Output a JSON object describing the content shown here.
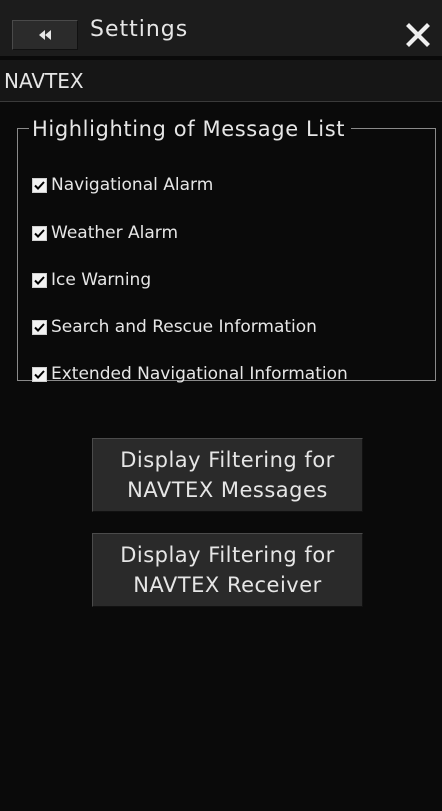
{
  "window": {
    "title": "Settings",
    "collapse_icon": "double-chevron-left-icon",
    "close_icon": "close-icon"
  },
  "section": {
    "title": "NAVTEX"
  },
  "highlight_group": {
    "legend": "Highlighting of Message List",
    "items": [
      {
        "label": "Navigational Alarm",
        "checked": true
      },
      {
        "label": "Weather Alarm",
        "checked": true
      },
      {
        "label": "Ice Warning",
        "checked": true
      },
      {
        "label": "Search and Rescue Information",
        "checked": true
      },
      {
        "label": "Extended Navigational Information",
        "checked": true
      }
    ]
  },
  "buttons": {
    "filter_messages": {
      "line1": "Display Filtering for",
      "line2": "NAVTEX Messages"
    },
    "filter_receiver": {
      "line1": "Display Filtering for",
      "line2": "NAVTEX Receiver"
    }
  },
  "colors": {
    "background": "#0a0a0a",
    "text": "#e6e6e6",
    "button_face": "#2a2a2a",
    "group_border": "#8a8a8a"
  }
}
